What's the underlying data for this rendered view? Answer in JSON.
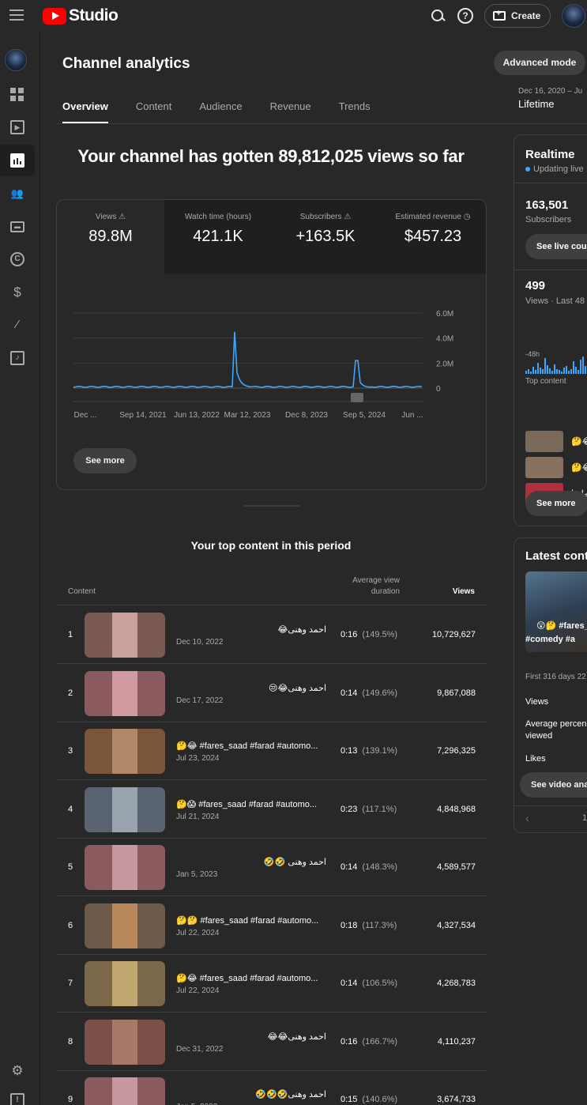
{
  "topbar": {
    "logo_text": "Studio",
    "create_label": "Create"
  },
  "page": {
    "title": "Channel analytics",
    "advanced_mode_label": "Advanced mode",
    "tabs": [
      {
        "label": "Overview",
        "active": true
      },
      {
        "label": "Content",
        "active": false
      },
      {
        "label": "Audience",
        "active": false
      },
      {
        "label": "Revenue",
        "active": false
      },
      {
        "label": "Trends",
        "active": false
      }
    ],
    "date_range_text": "Dec 16, 2020 – Ju",
    "date_range_value": "Lifetime",
    "headline": "Your channel has gotten 89,812,025 views so far"
  },
  "metrics": [
    {
      "label": "Views",
      "value": "89.8M",
      "icon": "warning-icon",
      "active": true
    },
    {
      "label": "Watch time (hours)",
      "value": "421.1K",
      "icon": "",
      "active": false
    },
    {
      "label": "Subscribers",
      "value": "+163.5K",
      "icon": "warning-icon",
      "active": false
    },
    {
      "label": "Estimated revenue",
      "value": "$457.23",
      "icon": "clock-icon",
      "active": false
    }
  ],
  "chart_data": {
    "type": "line",
    "series": [
      {
        "color": "#3ea6ff"
      }
    ],
    "y_ticks": [
      "6.0M",
      "4.0M",
      "2.0M",
      "0"
    ],
    "ylim": [
      0,
      6000000
    ],
    "x_tick_labels": [
      "Dec ...",
      "Sep 14, 2021",
      "Jun 13, 2022",
      "Mar 12, 2023",
      "Dec 8, 2023",
      "Sep 5, 2024",
      "Jun ..."
    ],
    "peaks": [
      {
        "x": "Dec 10, 2022",
        "y": 4500000
      },
      {
        "x": "Jul 22, 2024",
        "y": 2200000
      }
    ],
    "grid": true
  },
  "see_more_label": "See more",
  "top_content": {
    "title": "Your top content in this period",
    "headers": {
      "content": "Content",
      "avd": "Average view duration",
      "views": "Views"
    },
    "rows": [
      {
        "rank": "1",
        "title": "احمد وهنى😂",
        "date": "Dec 10, 2022",
        "avd": "0:16",
        "pct": "(149.5%)",
        "views": "10,729,627",
        "thumb_bg": "#7a5a52",
        "thumb_fg": "#c9a09a"
      },
      {
        "rank": "2",
        "title": "احمد وهنى😂😒",
        "date": "Dec 17, 2022",
        "avd": "0:14",
        "pct": "(149.6%)",
        "views": "9,867,088",
        "thumb_bg": "#8a5a5e",
        "thumb_fg": "#d09aa0"
      },
      {
        "rank": "3",
        "title": "🤔😂 #fares_saad #farad #automo...",
        "date": "Jul 23, 2024",
        "avd": "0:13",
        "pct": "(139.1%)",
        "views": "7,296,325",
        "thumb_bg": "#7a553a",
        "thumb_fg": "#b08868"
      },
      {
        "rank": "4",
        "title": "🤔😱 #fares_saad #farad #automo...",
        "date": "Jul 21, 2024",
        "avd": "0:23",
        "pct": "(117.1%)",
        "views": "4,848,968",
        "thumb_bg": "#5a6470",
        "thumb_fg": "#9aa4ae"
      },
      {
        "rank": "5",
        "title": "احمد وهنى 🤣🤣",
        "date": "Jan 5, 2023",
        "avd": "0:14",
        "pct": "(148.3%)",
        "views": "4,589,577",
        "thumb_bg": "#8a5a5e",
        "thumb_fg": "#c898a0"
      },
      {
        "rank": "6",
        "title": "🤔🤔 #fares_saad #farad #automo...",
        "date": "Jul 22, 2024",
        "avd": "0:18",
        "pct": "(117.3%)",
        "views": "4,327,534",
        "thumb_bg": "#6e5a48",
        "thumb_fg": "#b8885a"
      },
      {
        "rank": "7",
        "title": "🤔😂 #fares_saad #farad #automo...",
        "date": "Jul 22, 2024",
        "avd": "0:14",
        "pct": "(106.5%)",
        "views": "4,268,783",
        "thumb_bg": "#7a6848",
        "thumb_fg": "#c0a870"
      },
      {
        "rank": "8",
        "title": "احمد وهنى😂😂",
        "date": "Dec 31, 2022",
        "avd": "0:16",
        "pct": "(166.7%)",
        "views": "4,110,237",
        "thumb_bg": "#7a5048",
        "thumb_fg": "#a87868"
      },
      {
        "rank": "9",
        "title": "احمد وهنى🤣🤣🤣",
        "date": "Jan 5, 2023",
        "avd": "0:15",
        "pct": "(140.6%)",
        "views": "3,674,733",
        "thumb_bg": "#8a5a5e",
        "thumb_fg": "#c898a0"
      }
    ]
  },
  "realtime": {
    "title": "Realtime",
    "updating": "Updating live",
    "subs_value": "163,501",
    "subs_label": "Subscribers",
    "see_live_label": "See live cou",
    "views_value": "499",
    "views_label": "Views · Last 48",
    "axis_label": "-48h",
    "top_content_label": "Top content",
    "top_items": [
      {
        "title": "🤔😂",
        "color": "#7a6858"
      },
      {
        "title": "🤔😂",
        "color": "#8a7060"
      },
      {
        "title": "ماصا",
        "color": "#b03040"
      }
    ],
    "see_more_label": "See more"
  },
  "latest": {
    "title": "Latest cont",
    "thumb_text_1": "😲🤔 #fares_",
    "thumb_text_2": "#comedy #a",
    "first_days": "First 316 days 22",
    "rows": [
      "Views",
      "Average percen",
      "viewed",
      "Likes"
    ],
    "see_video_label": "See video ana",
    "page_number": "1"
  }
}
